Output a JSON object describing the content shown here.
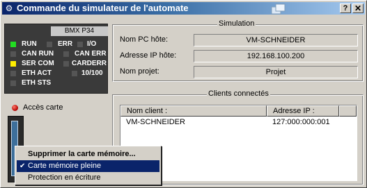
{
  "window": {
    "title": "Commande du simulateur de l'automate"
  },
  "titlebar_buttons": {
    "help": "?",
    "close": "✕"
  },
  "plc": {
    "model": "BMX P34",
    "leds": [
      {
        "label": "RUN",
        "color": "#22dd22"
      },
      {
        "label": "ERR",
        "color": "#555555"
      },
      {
        "label": "I/O",
        "color": "#555555"
      },
      {
        "label": "CAN RUN",
        "color": "#555555"
      },
      {
        "label": "CAN ERR",
        "color": "#555555"
      },
      {
        "label": "SER COM",
        "color": "#ffee00"
      },
      {
        "label": "CARDERR",
        "color": "#555555"
      },
      {
        "label": "ETH ACT",
        "color": "#555555"
      },
      {
        "label": "10/100",
        "color": "#555555"
      },
      {
        "label": "ETH STS",
        "color": "#555555"
      }
    ]
  },
  "card_access": {
    "label": "Accès carte"
  },
  "simulation": {
    "title": "Simulation",
    "fields": [
      {
        "label": "Nom PC hôte:",
        "value": "VM-SCHNEIDER"
      },
      {
        "label": "Adresse IP hôte:",
        "value": "192.168.100.200"
      },
      {
        "label": "Nom projet:",
        "value": "Projet"
      }
    ]
  },
  "clients": {
    "title": "Clients connectés",
    "columns": [
      "Nom client :",
      "Adresse IP :"
    ],
    "rows": [
      [
        "VM-SCHNEIDER",
        "127:000:000:001"
      ]
    ]
  },
  "context_menu": {
    "items": [
      {
        "label": "Supprimer la carte mémoire...",
        "bold": true,
        "checked": false,
        "highlighted": false
      },
      {
        "label": "Carte mémoire pleine",
        "bold": false,
        "checked": true,
        "highlighted": true
      },
      {
        "label": "Protection en écriture",
        "bold": false,
        "checked": false,
        "highlighted": false
      }
    ]
  }
}
